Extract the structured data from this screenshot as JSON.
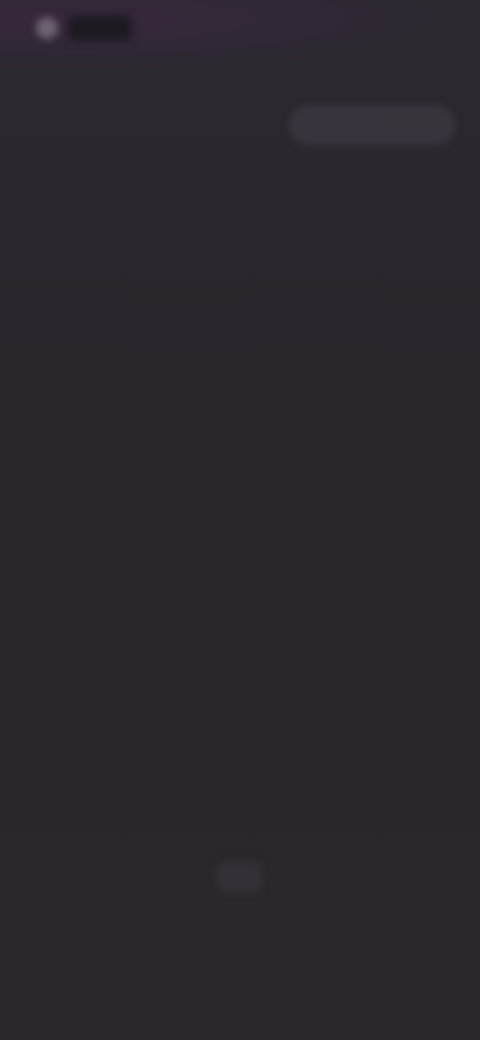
{
  "header": {
    "brand_name": "",
    "action_label": ""
  },
  "content": {
    "heading": "",
    "body": ""
  },
  "footer": {
    "middle_label": "",
    "icon": "app-icon",
    "link": ""
  },
  "colors": {
    "background": "#2b272c",
    "text_muted": "#8e8792"
  }
}
